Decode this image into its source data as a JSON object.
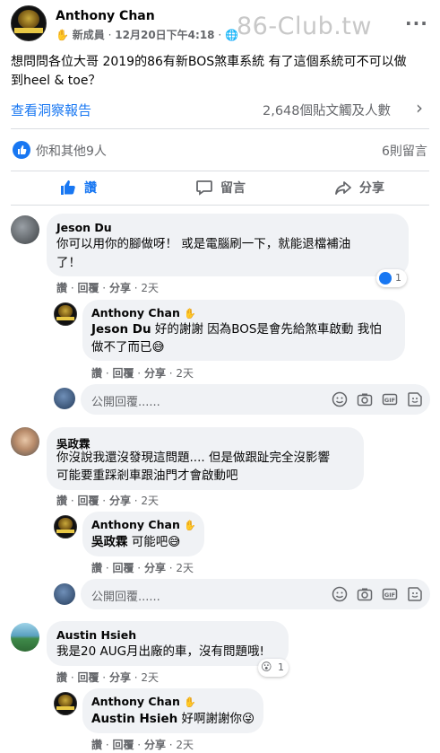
{
  "post": {
    "author": "Anthony Chan",
    "badge_icon": "wave-icon",
    "role": "新成員",
    "date": "12月20日下午4:18",
    "dot": "·",
    "watermark": "86-Club.tw",
    "text_line1": "想問問各位大哥 2019的86有新BOS煞車系統 有了這個系統可不可以做",
    "text_line2": "到heel & toe？",
    "insights_link": "查看洞察報告",
    "insights_stats": "2,648個貼文觸及人數",
    "reactions_text": "你和其他9人",
    "comments_count": "6則留言"
  },
  "actions": {
    "like": "讚",
    "comment": "留言",
    "share": "分享"
  },
  "comments": [
    {
      "name": "Jeson Du",
      "line1": "你可以用你的腳做呀！ 或是電腦刷一下，就能退檔補油",
      "line2": "了！",
      "like": "讚",
      "reply": "回覆",
      "share": "分享",
      "time": "2天",
      "reaction_count": "1",
      "reply_item": {
        "name": "Anthony Chan",
        "mention": "Jeson Du",
        "line1": " 好的謝謝 因為BOS是會先給煞車啟動 我怕",
        "line2": "做不了而已😅",
        "like": "讚",
        "reply": "回覆",
        "share": "分享",
        "time": "2天"
      }
    },
    {
      "name": "吳政霖",
      "line1": "你沒說我還沒發現這問題.... 但是做跟趾完全沒影響",
      "line2": "可能要重踩剎車跟油門才會啟動吧",
      "like": "讚",
      "reply": "回覆",
      "share": "分享",
      "time": "2天",
      "reply_item": {
        "name": "Anthony Chan",
        "mention": "吳政霖",
        "line1": " 可能吧😅",
        "like": "讚",
        "reply": "回覆",
        "share": "分享",
        "time": "2天"
      }
    },
    {
      "name": "Austin Hsieh",
      "line1": "我是20 AUG月出廠的車，沒有問題哦!",
      "like": "讚",
      "reply": "回覆",
      "share": "分享",
      "time": "2天",
      "reaction_count": "1",
      "reply_item": {
        "name": "Anthony Chan",
        "mention": "Austin Hsieh",
        "line1": " 好啊謝謝你😜",
        "like": "讚",
        "reply": "回覆",
        "share": "分享",
        "time": "2天"
      }
    }
  ],
  "reply_placeholder": "公開回覆......",
  "colors": {
    "like_blue": "#1877f2",
    "text": "#050505",
    "secondary": "#65676b",
    "bubble": "#f0f2f5"
  }
}
